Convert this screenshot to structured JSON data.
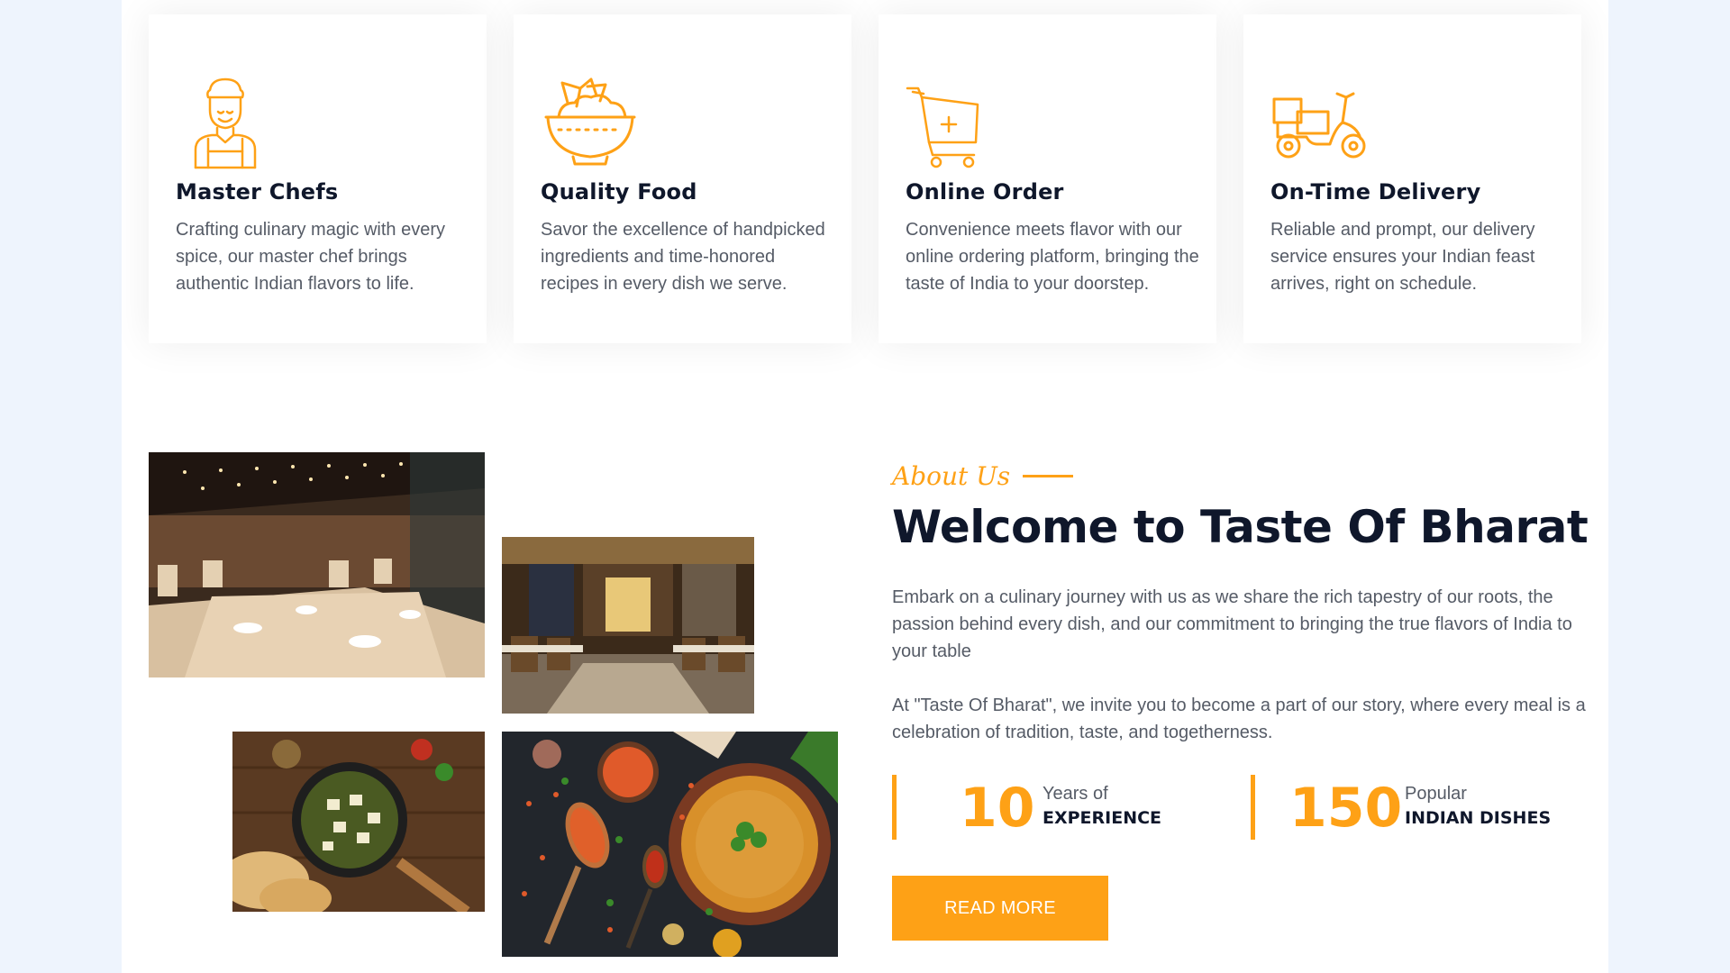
{
  "services": [
    {
      "icon": "chef-icon",
      "title": "Master Chefs",
      "desc": "Crafting culinary magic with every spice, our master chef brings authentic Indian flavors to life."
    },
    {
      "icon": "food-bowl-icon",
      "title": "Quality Food",
      "desc": "Savor the excellence of handpicked ingredients and time-honored recipes in every dish we serve."
    },
    {
      "icon": "shopping-cart-icon",
      "title": "Online Order",
      "desc": "Convenience meets flavor with our online ordering platform, bringing the taste of India to your doorstep."
    },
    {
      "icon": "delivery-scooter-icon",
      "title": "On-Time Delivery",
      "desc": "Reliable and prompt, our delivery service ensures your Indian feast arrives, right on schedule."
    }
  ],
  "about": {
    "tag": "About Us",
    "title": "Welcome to Taste Of Bharat",
    "para1": "Embark on a culinary journey with us as we share the rich tapestry of our roots, the passion behind every dish, and our commitment to bringing the true flavors of India to your table",
    "para2": "At \"Taste Of Bharat\", we invite you to become a part of our story, where every meal is a celebration of tradition, taste, and togetherness.",
    "stats": [
      {
        "number": "10",
        "label1": "Years of",
        "label2": "EXPERIENCE"
      },
      {
        "number": "150",
        "label1": "Popular",
        "label2": "INDIAN DISHES"
      }
    ],
    "button": "READ MORE"
  },
  "colors": {
    "accent": "#fea116",
    "dark": "#0f172b",
    "text": "#555b66",
    "page_bg": "#eef4fd"
  }
}
